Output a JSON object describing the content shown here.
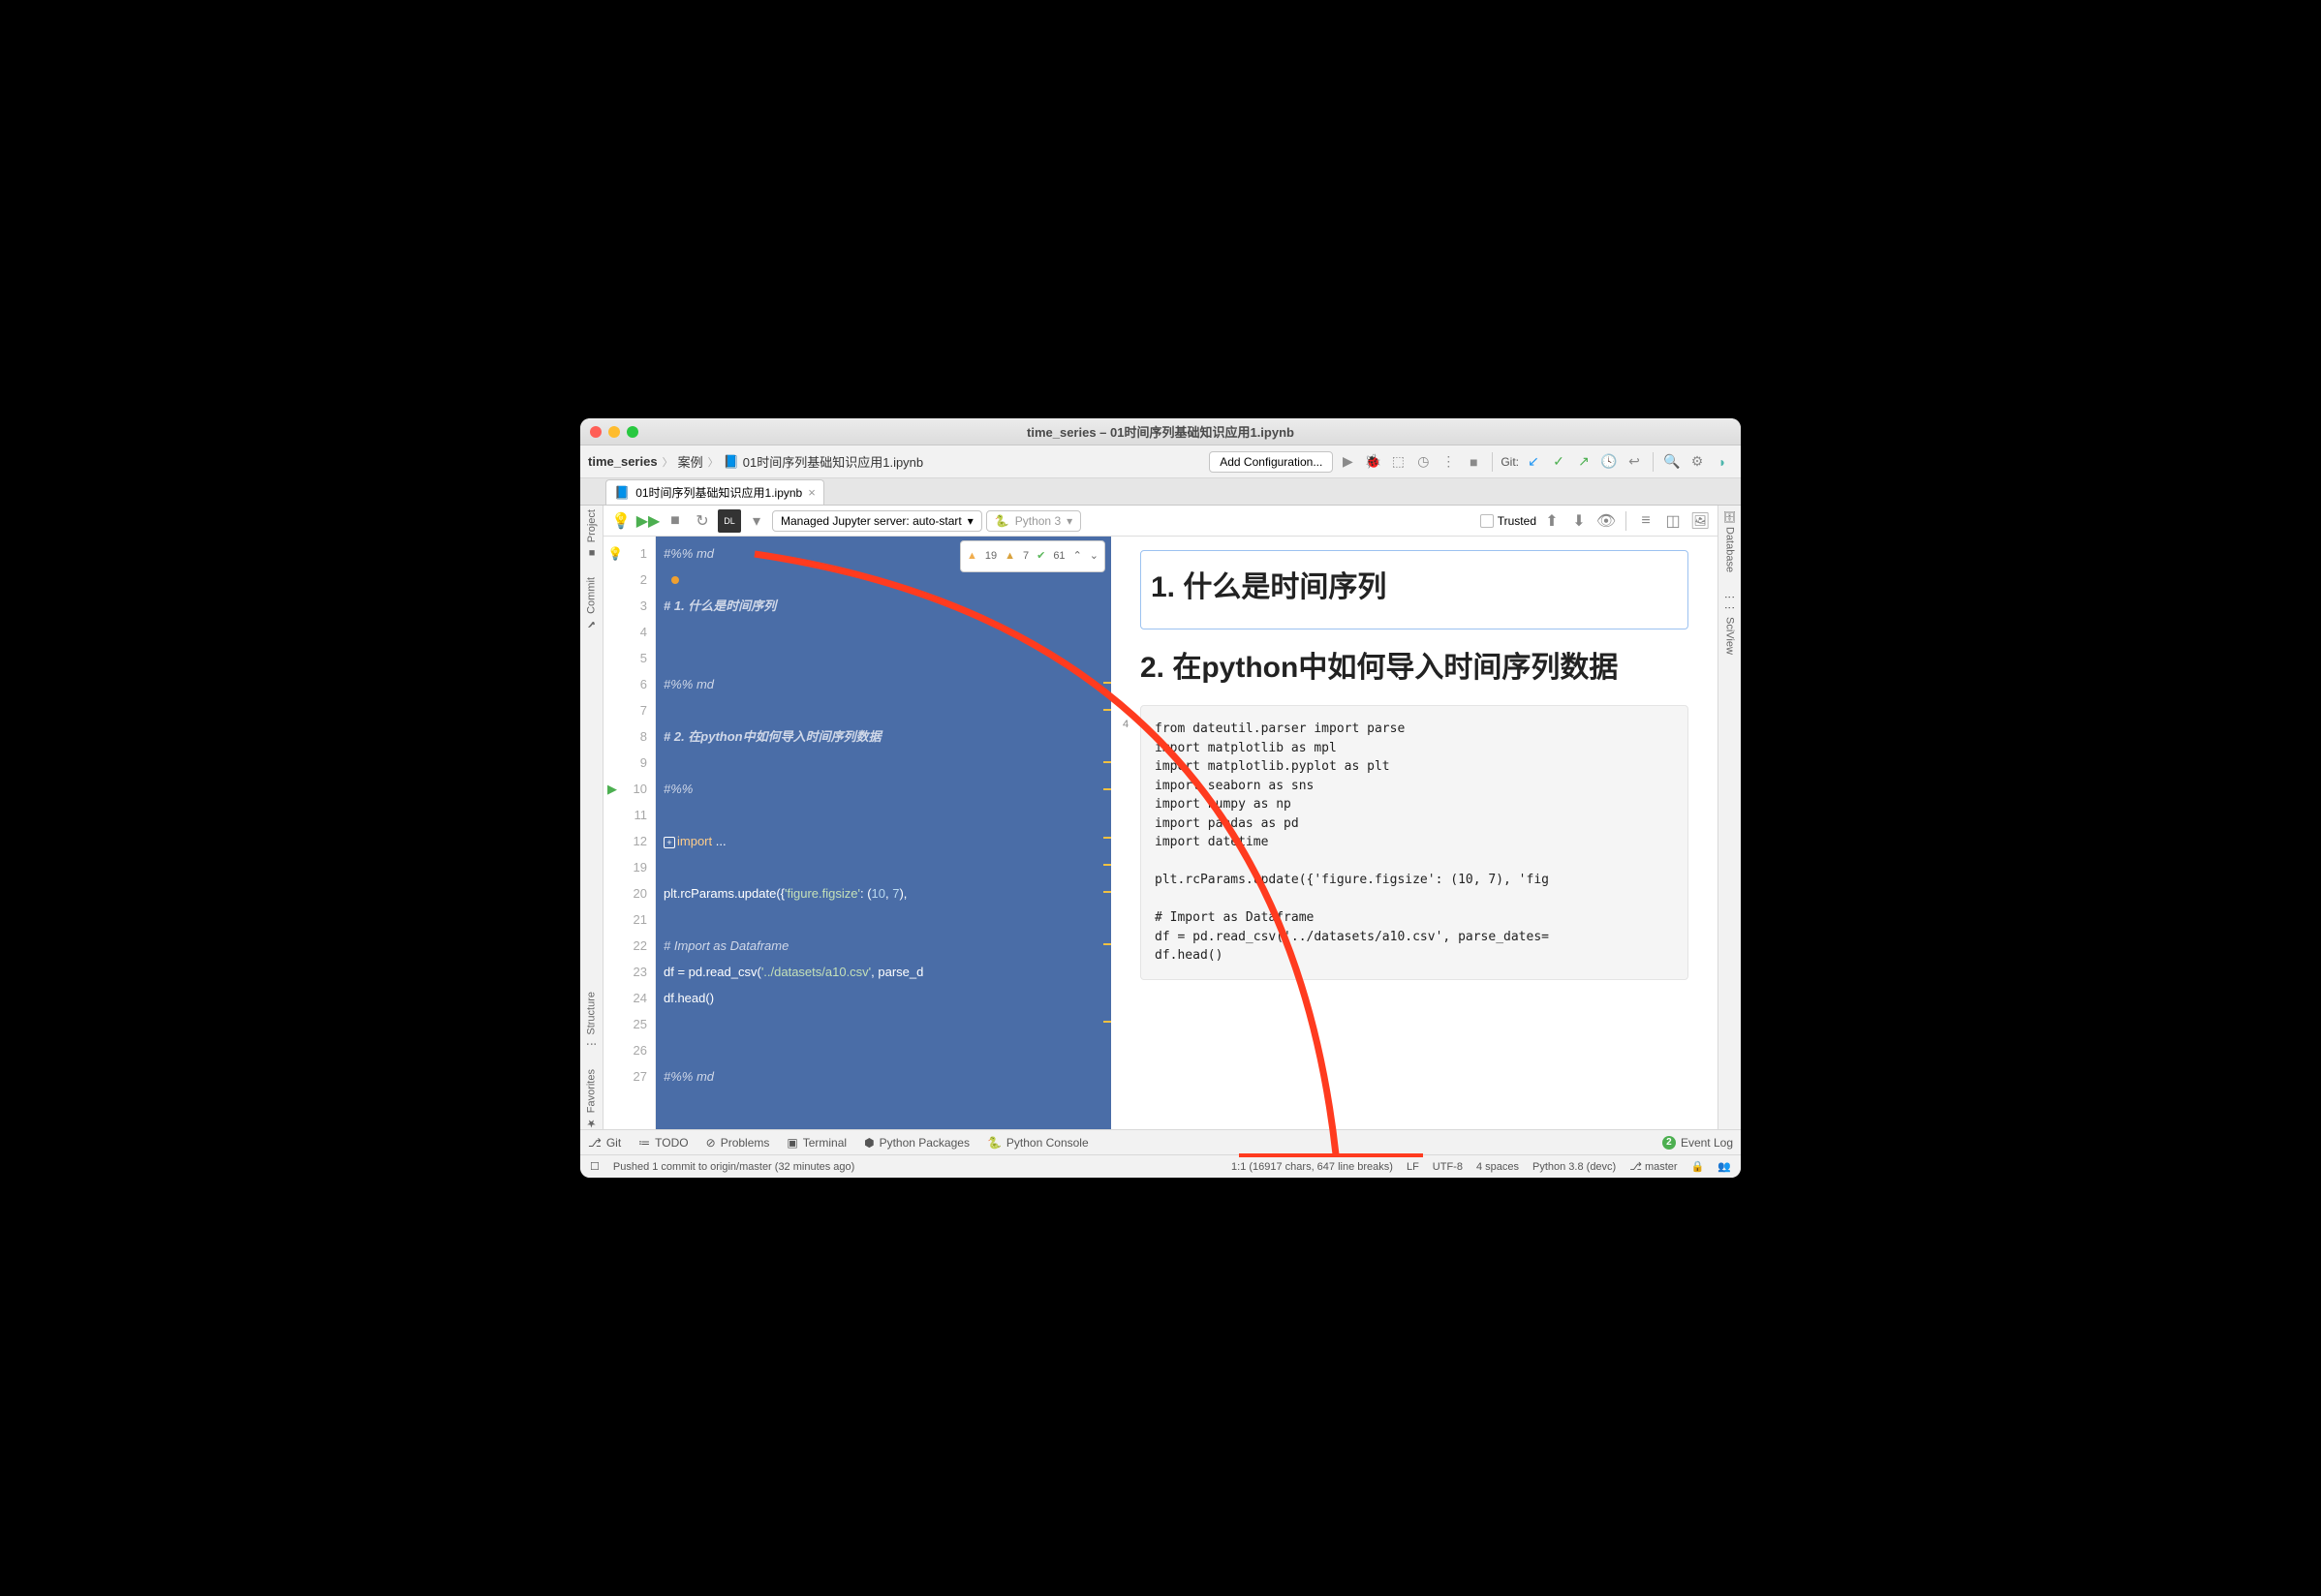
{
  "window": {
    "title": "time_series – 01时间序列基础知识应用1.ipynb"
  },
  "breadcrumb": {
    "root": "time_series",
    "folder": "案例",
    "file": "01时间序列基础知识应用1.ipynb"
  },
  "toolbar": {
    "addConfig": "Add Configuration...",
    "gitLabel": "Git:"
  },
  "tab": {
    "name": "01时间序列基础知识应用1.ipynb"
  },
  "notebook": {
    "serverDropdown": "Managed Jupyter server: auto-start",
    "kernelDropdown": "Python 3",
    "trustedLabel": "Trusted"
  },
  "inspections": {
    "warn1": "19",
    "warn2": "7",
    "ok": "61"
  },
  "gutter": [
    "1",
    "2",
    "3",
    "4",
    "5",
    "6",
    "7",
    "8",
    "9",
    "10",
    "11",
    "12",
    "19",
    "20",
    "21",
    "22",
    "23",
    "24",
    "25",
    "26",
    "27"
  ],
  "code": {
    "l1": "#%% md",
    "l3": "# 1. 什么是时间序列",
    "l6": "#%% md",
    "l8": "# 2. 在python中如何导入时间序列数据",
    "l10": "#%%",
    "l12a": "import",
    "l12b": " ...",
    "l20a": "plt.rcParams.update({",
    "l20b": "'figure.figsize'",
    "l20c": ": (",
    "l20d": "10",
    "l20e": ", ",
    "l20f": "7",
    "l20g": "),",
    "l22": "# Import as Dataframe",
    "l23a": "df = pd.read_csv(",
    "l23b": "'../datasets/a10.csv'",
    "l23c": ", parse_d",
    "l24": "df.head()",
    "l27": "#%% md"
  },
  "preview": {
    "h1": "1. 什么是时间序列",
    "h2": "2. 在python中如何导入时间序列数据",
    "cellCount": "4",
    "codeBlock": "from dateutil.parser import parse\nimport matplotlib as mpl\nimport matplotlib.pyplot as plt\nimport seaborn as sns\nimport numpy as np\nimport pandas as pd\nimport datetime\n\nplt.rcParams.update({'figure.figsize': (10, 7), 'fig\n\n# Import as Dataframe\ndf = pd.read_csv('../datasets/a10.csv', parse_dates=\ndf.head()"
  },
  "rails": {
    "project": "Project",
    "commit": "Commit",
    "structure": "Structure",
    "favorites": "Favorites",
    "database": "Database",
    "sciview": "SciView"
  },
  "tools": {
    "git": "Git",
    "todo": "TODO",
    "problems": "Problems",
    "terminal": "Terminal",
    "pyPackages": "Python Packages",
    "pyConsole": "Python Console",
    "eventLog": "Event Log"
  },
  "status": {
    "pushMsg": "Pushed 1 commit to origin/master (32 minutes ago)",
    "position": "1:1 (16917 chars, 647 line breaks)",
    "lineEnding": "LF",
    "encoding": "UTF-8",
    "indent": "4 spaces",
    "interpreter": "Python 3.8 (devc)",
    "branch": "master"
  }
}
